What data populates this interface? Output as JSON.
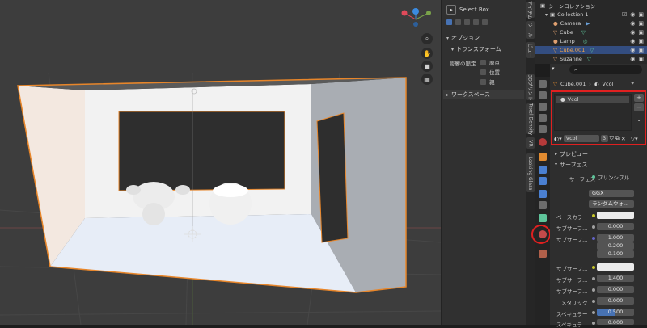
{
  "tool_panel": {
    "tool_name": "Select Box",
    "options_header": "オプション",
    "transform_header": "トランスフォーム",
    "affect_only_label": "影響の限定",
    "affect_origins": "原点",
    "affect_locations": "位置",
    "affect_parents": "親",
    "workspace_header": "ワークスペース"
  },
  "vertical_tabs": [
    "アイテム",
    "ツール",
    "ビュー",
    "3Dプリント",
    "Texel Density",
    "VR",
    "Looking Glass"
  ],
  "outliner": {
    "scene_collection": "シーンコレクション",
    "collection": "Collection 1",
    "items": [
      {
        "name": "Camera",
        "color": "#e0a070"
      },
      {
        "name": "Cube",
        "color": "#e0a070"
      },
      {
        "name": "Lamp",
        "color": "#e0a070"
      },
      {
        "name": "Cube.001",
        "color": "#f2a54a"
      },
      {
        "name": "Suzanne",
        "color": "#e0a070"
      }
    ],
    "selected_color": "#334d80"
  },
  "properties": {
    "search_placeholder": "",
    "breadcrumb_object": "Cube.001",
    "breadcrumb_material": "Vcol",
    "slot_name": "Vcol",
    "material_name": "Vcol",
    "user_count": "3",
    "preview_header": "プレビュー",
    "surface_header": "サーフェス",
    "surface_label": "サーフェス",
    "surface_value": "プリンシプル...",
    "distribution": "GGX",
    "subsurface_method": "ランダムウォ...",
    "rows": [
      {
        "label": "ベースカラー",
        "value": "",
        "kind": "color"
      },
      {
        "label": "サブサーフ...",
        "value": "0.000",
        "kind": "num"
      },
      {
        "label": "サブサーフ...",
        "value": "1.000",
        "kind": "num"
      },
      {
        "label": "",
        "value": "0.200",
        "kind": "num"
      },
      {
        "label": "",
        "value": "0.100",
        "kind": "num"
      },
      {
        "label": "サブサーフ...",
        "value": "",
        "kind": "color"
      },
      {
        "label": "サブサーフ...",
        "value": "1.400",
        "kind": "num"
      },
      {
        "label": "サブサーフ...",
        "value": "0.000",
        "kind": "num"
      },
      {
        "label": "メタリック",
        "value": "0.000",
        "kind": "num"
      },
      {
        "label": "スペキュラー",
        "value": "0.500",
        "kind": "num-active"
      },
      {
        "label": "スペキュラ...",
        "value": "0.000",
        "kind": "num"
      }
    ]
  },
  "highlight_color": "#e02020"
}
